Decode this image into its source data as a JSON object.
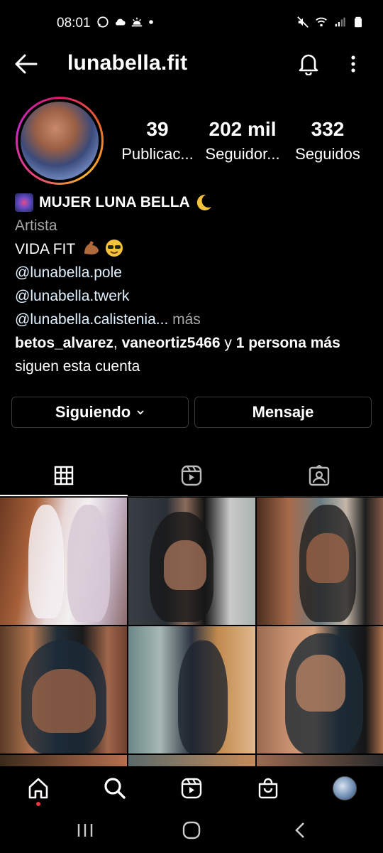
{
  "status_bar": {
    "time": "08:01",
    "icons_left": [
      "whatsapp-icon",
      "cloud-icon",
      "weather-sunrise-icon",
      "dot"
    ],
    "icons_right": [
      "mute-icon",
      "wifi-icon",
      "signal-icon",
      "battery-icon"
    ]
  },
  "header": {
    "username": "lunabella.fit",
    "back_icon": "arrow-left-icon",
    "bell_icon": "bell-icon",
    "menu_icon": "more-vertical-icon"
  },
  "profile": {
    "stats": [
      {
        "value": "39",
        "label": "Publicac..."
      },
      {
        "value": "202 mil",
        "label": "Seguidor..."
      },
      {
        "value": "332",
        "label": "Seguidos"
      }
    ]
  },
  "bio": {
    "name": "MUJER LUNA BELLA",
    "category": "Artista",
    "line1": "VIDA FIT",
    "mention1": "@lunabella.pole",
    "mention2": "@lunabella.twerk",
    "mention3": "@lunabella.calistenia...",
    "more": " más",
    "followed_by_1": "betos_alvarez",
    "followed_sep": ", ",
    "followed_by_2": "vaneortiz5466",
    "followed_and": " y ",
    "followed_others": "1 persona más",
    "followed_suffix": "siguen esta cuenta"
  },
  "actions": {
    "following_label": "Siguiendo",
    "message_label": "Mensaje"
  },
  "tabs": [
    "grid-icon",
    "reels-icon",
    "tagged-icon"
  ],
  "bottom_nav": [
    "home-icon",
    "search-icon",
    "reels-icon",
    "shop-icon",
    "profile-avatar"
  ],
  "colors": {
    "background": "#000000",
    "text": "#ffffff",
    "secondary_text": "#a8a8a8",
    "mention": "#e0f1ff",
    "border": "#3a3a3a",
    "notification_dot": "#ff3040"
  }
}
